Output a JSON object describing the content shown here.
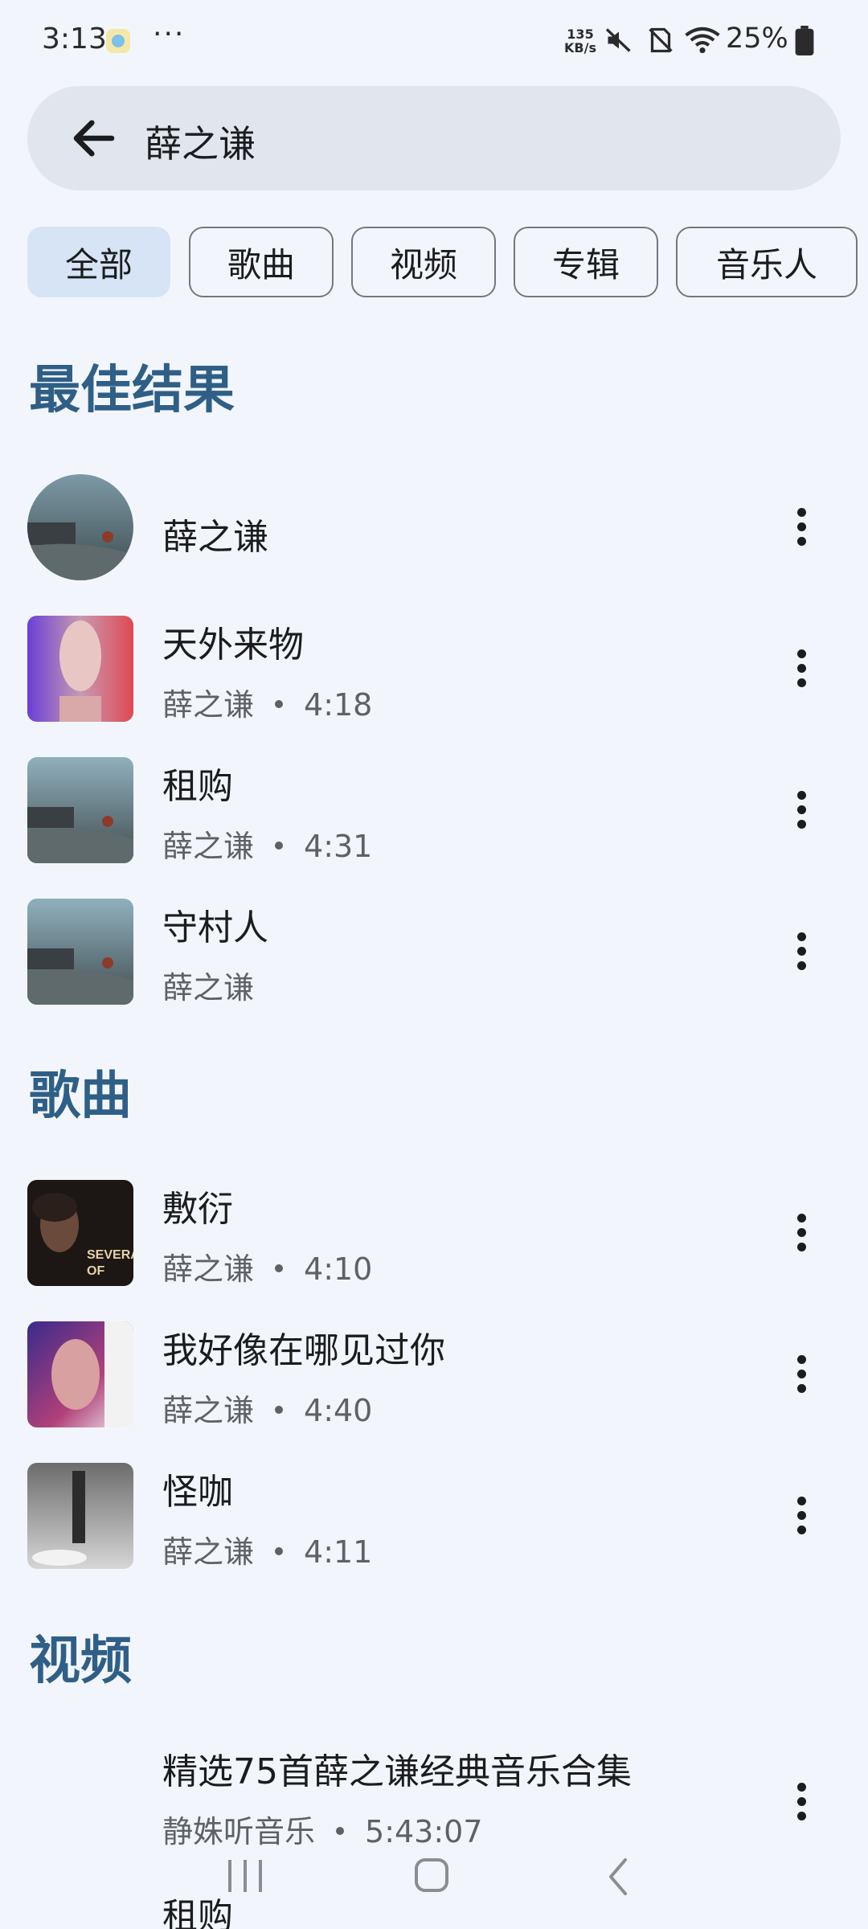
{
  "status_bar": {
    "time": "3:13",
    "dots": "···",
    "net_speed_value": "135",
    "net_speed_unit": "KB/s",
    "battery": "25%"
  },
  "search": {
    "query": "薛之谦"
  },
  "chips": [
    "全部",
    "歌曲",
    "视频",
    "专辑",
    "音乐人"
  ],
  "sections": {
    "top_results": "最佳结果",
    "songs": "歌曲",
    "videos": "视频"
  },
  "top_results": [
    {
      "title": "薛之谦",
      "subtitle_artist": "",
      "duration": ""
    },
    {
      "title": "天外来物",
      "subtitle_artist": "薛之谦",
      "duration": "4:18"
    },
    {
      "title": "租购",
      "subtitle_artist": "薛之谦",
      "duration": "4:31"
    },
    {
      "title": "守村人",
      "subtitle_artist": "薛之谦",
      "duration": ""
    }
  ],
  "songs": [
    {
      "title": "敷衍",
      "subtitle_artist": "薛之谦",
      "duration": "4:10",
      "cover_text": "SEVERAL OF"
    },
    {
      "title": "我好像在哪见过你",
      "subtitle_artist": "薛之谦",
      "duration": "4:40"
    },
    {
      "title": "怪咖",
      "subtitle_artist": "薛之谦",
      "duration": "4:11"
    }
  ],
  "videos": [
    {
      "title": "精选75首薛之谦经典音乐合集",
      "subtitle_artist": "静姝听音乐",
      "duration": "5:43:07"
    },
    {
      "title": "租购"
    }
  ],
  "colors": {
    "background": "#f2f6fc",
    "accent_heading": "#2f5f86",
    "chip_selected": "#d6e4f6",
    "search_bg": "#e1e6ee"
  }
}
